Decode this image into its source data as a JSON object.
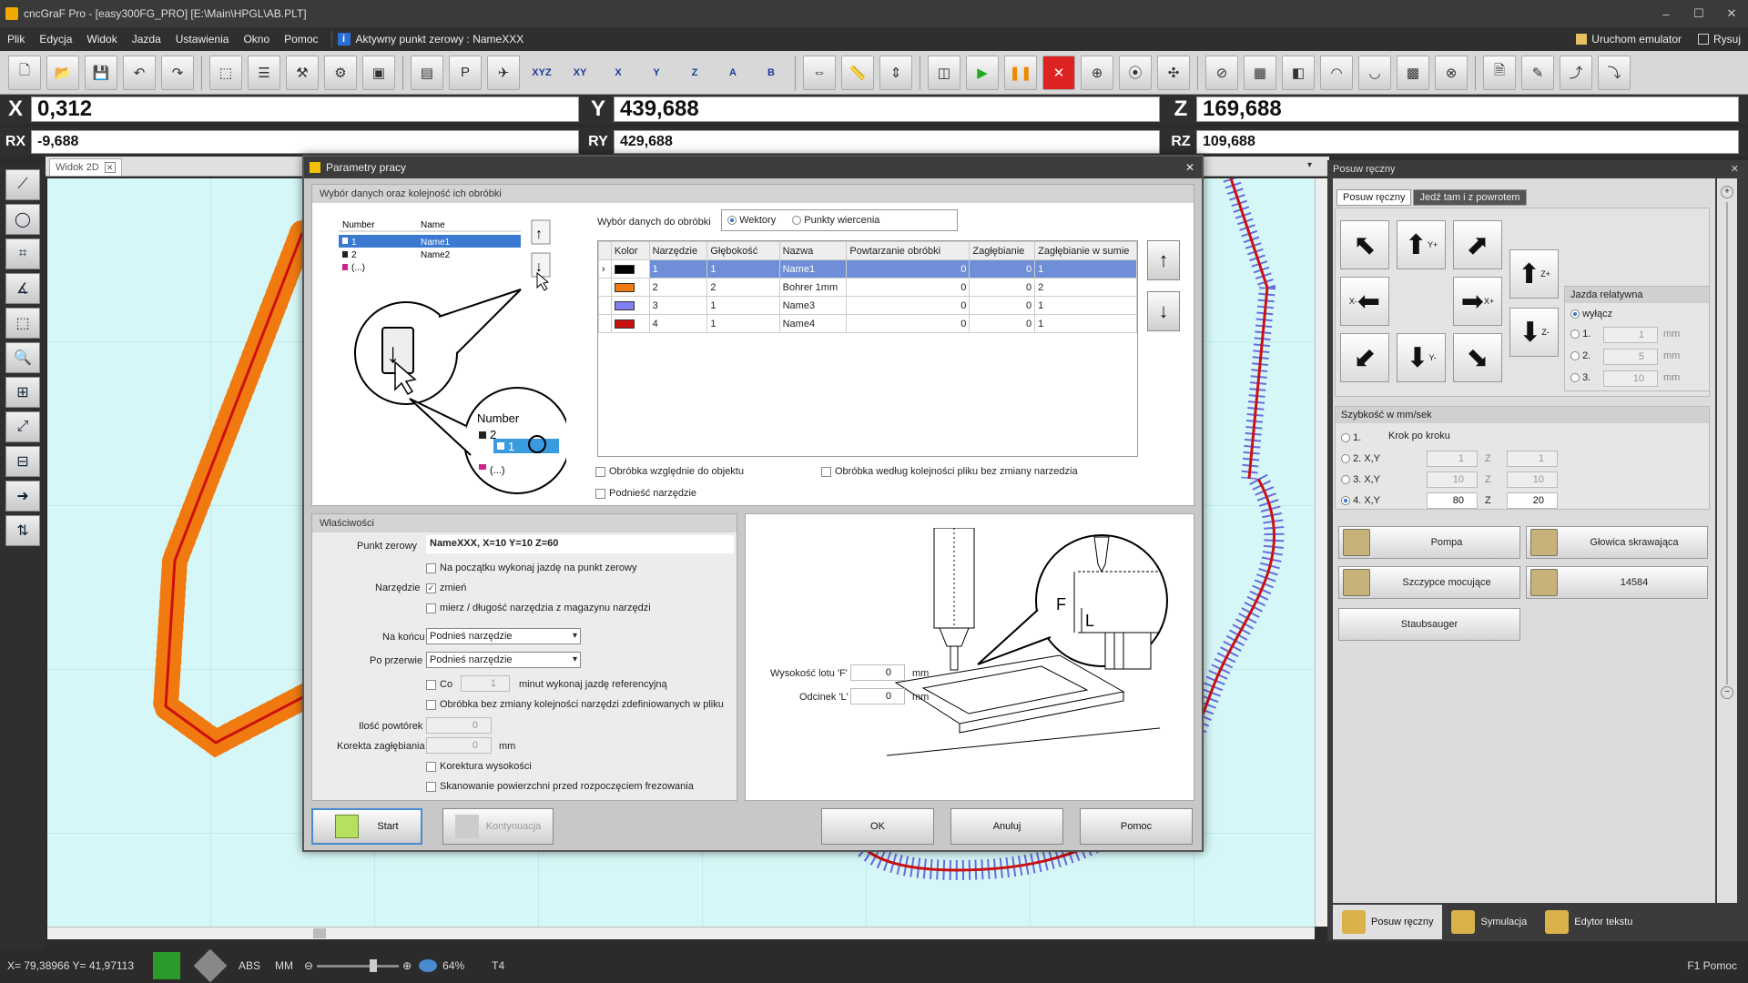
{
  "window": {
    "title": "cncGraF Pro - [easy300FG_PRO] [E:\\Main\\HPGL\\AB.PLT]"
  },
  "menu": {
    "items": [
      "Plik",
      "Edycja",
      "Widok",
      "Jazda",
      "Ustawienia",
      "Okno",
      "Pomoc"
    ],
    "active_zero": "Aktywny punkt zerowy : NameXXX",
    "emulator": "Uruchom emulator",
    "draw": "Rysuj"
  },
  "toolbar": {
    "axis_labels": [
      "XYZ",
      "XY",
      "X",
      "Y",
      "Z",
      "A",
      "B"
    ]
  },
  "coords": {
    "x_label": "X",
    "x": "0,312",
    "y_label": "Y",
    "y": "439,688",
    "z_label": "Z",
    "z": "169,688",
    "rx_label": "RX",
    "rx": "-9,688",
    "ry_label": "RY",
    "ry": "429,688",
    "rz_label": "RZ",
    "rz": "109,688"
  },
  "doc": {
    "tab": "Widok 2D"
  },
  "dialog": {
    "title": "Parametry pracy",
    "sect1": "Wybór danych oraz kolejność ich obróbki",
    "mini_table": {
      "h_number": "Number",
      "h_name": "Name",
      "rows": [
        [
          "1",
          "Name1"
        ],
        [
          "2",
          "Name2"
        ],
        [
          "(...)",
          ""
        ]
      ]
    },
    "callout": {
      "number": "Number",
      "n2": "2",
      "n1": "1",
      "more": "(...)"
    },
    "select_label": "Wybór danych do obróbki",
    "opt_vectors": "Wektory",
    "opt_drill": "Punkty wiercenia",
    "table": {
      "headers": [
        "Kolor",
        "Narzędzie",
        "Głębokość",
        "Nazwa",
        "Powtarzanie obróbki",
        "Zagłębianie",
        "Zagłębianie w sumie"
      ],
      "rows": [
        {
          "color": "#000000",
          "tool": "1",
          "depth": "1",
          "name": "Name1",
          "repeat": "0",
          "plunge": "0",
          "sum": "1"
        },
        {
          "color": "#f07a10",
          "tool": "2",
          "depth": "2",
          "name": "Bohrer 1mm",
          "repeat": "0",
          "plunge": "0",
          "sum": "2"
        },
        {
          "color": "#8080f0",
          "tool": "3",
          "depth": "1",
          "name": "Name3",
          "repeat": "0",
          "plunge": "0",
          "sum": "1"
        },
        {
          "color": "#cc1010",
          "tool": "4",
          "depth": "1",
          "name": "Name4",
          "repeat": "0",
          "plunge": "0",
          "sum": "1"
        }
      ]
    },
    "chk_relative": "Obróbka względnie do objektu",
    "chk_fileorder": "Obróbka według kolejności pliku bez zmiany narzedzia",
    "chk_lift": "Podnieść narzędzie",
    "props": "Właściwości",
    "zero_label": "Punkt zerowy",
    "zero_value": "NameXXX, X=10 Y=10 Z=60",
    "chk_start_zero": "Na początku wykonaj jazdę na punkt zerowy",
    "tool_label": "Narzędzie",
    "chk_change": "zmień",
    "chk_measure": "mierz / długość narzędzia z magazynu narzędzi",
    "end_label": "Na końcu",
    "end_value": "Podnieś narzędzie",
    "pause_label": "Po przerwie",
    "pause_value": "Podnieś narzędzie",
    "chk_every": "Co",
    "every_value": "1",
    "every_suffix": "minut wykonaj jazdę referencyjną",
    "chk_noorder": "Obróbka bez zmiany kolejności narzędzi zdefiniowanych w pliku",
    "repeats_label": "Ilość powtórek",
    "repeats_value": "0",
    "depthcorr_label": "Korekta zagłębiania",
    "depthcorr_value": "0",
    "depthcorr_unit": "mm",
    "chk_heightcorr": "Korektura wysokości",
    "chk_scan": "Skanowanie powierzchni przed rozpoczęciem frezowania",
    "flight_label": "Wysokość lotu 'F'",
    "flight_value": "0",
    "flight_unit": "mm",
    "seg_label": "Odcinek 'L'",
    "seg_value": "0",
    "seg_unit": "mm",
    "diag_f": "F",
    "diag_l": "L",
    "btn_start": "Start",
    "btn_continue": "Kontynuacja",
    "btn_ok": "OK",
    "btn_cancel": "Anuluj",
    "btn_help": "Pomoc"
  },
  "rpanel": {
    "title": "Posuw ręczny",
    "tab1": "Posuw ręczny",
    "tab2": "Jedź tam i z powrotem",
    "rel_title": "Jazda relatywna",
    "rel_off": "wyłącz",
    "rel_opts": [
      {
        "label": "1.",
        "value": "1"
      },
      {
        "label": "2.",
        "value": "5"
      },
      {
        "label": "3.",
        "value": "10"
      }
    ],
    "unit": "mm",
    "speed_title": "Szybkość w mm/sek",
    "step_label": "Krok po kroku",
    "speed_rows": [
      {
        "label": "1.",
        "xy": "",
        "z": ""
      },
      {
        "label": "2. X,Y",
        "xy": "1",
        "z": "1"
      },
      {
        "label": "3. X,Y",
        "xy": "10",
        "z": "10"
      },
      {
        "label": "4. X,Y",
        "xy": "80",
        "z": "20"
      }
    ],
    "z_label": "Z",
    "btn_pump": "Pompa",
    "btn_head": "Głowica skrawająca",
    "btn_clamp": "Szczypce mocujące",
    "btn_num": "14584",
    "btn_vac": "Staubsauger",
    "arrow_labels": {
      "yp": "Y+",
      "ym": "Y-",
      "xm": "X-",
      "xp": "X+",
      "zp": "Z+",
      "zm": "Z-"
    }
  },
  "bottom_tabs": [
    "Posuw ręczny",
    "Symulacja",
    "Edytor tekstu"
  ],
  "status": {
    "coords": "X= 79,38966 Y= 41,97113",
    "abs": "ABS",
    "mm": "MM",
    "zoom": "64%",
    "tool": "T4",
    "help": "F1 Pomoc"
  }
}
